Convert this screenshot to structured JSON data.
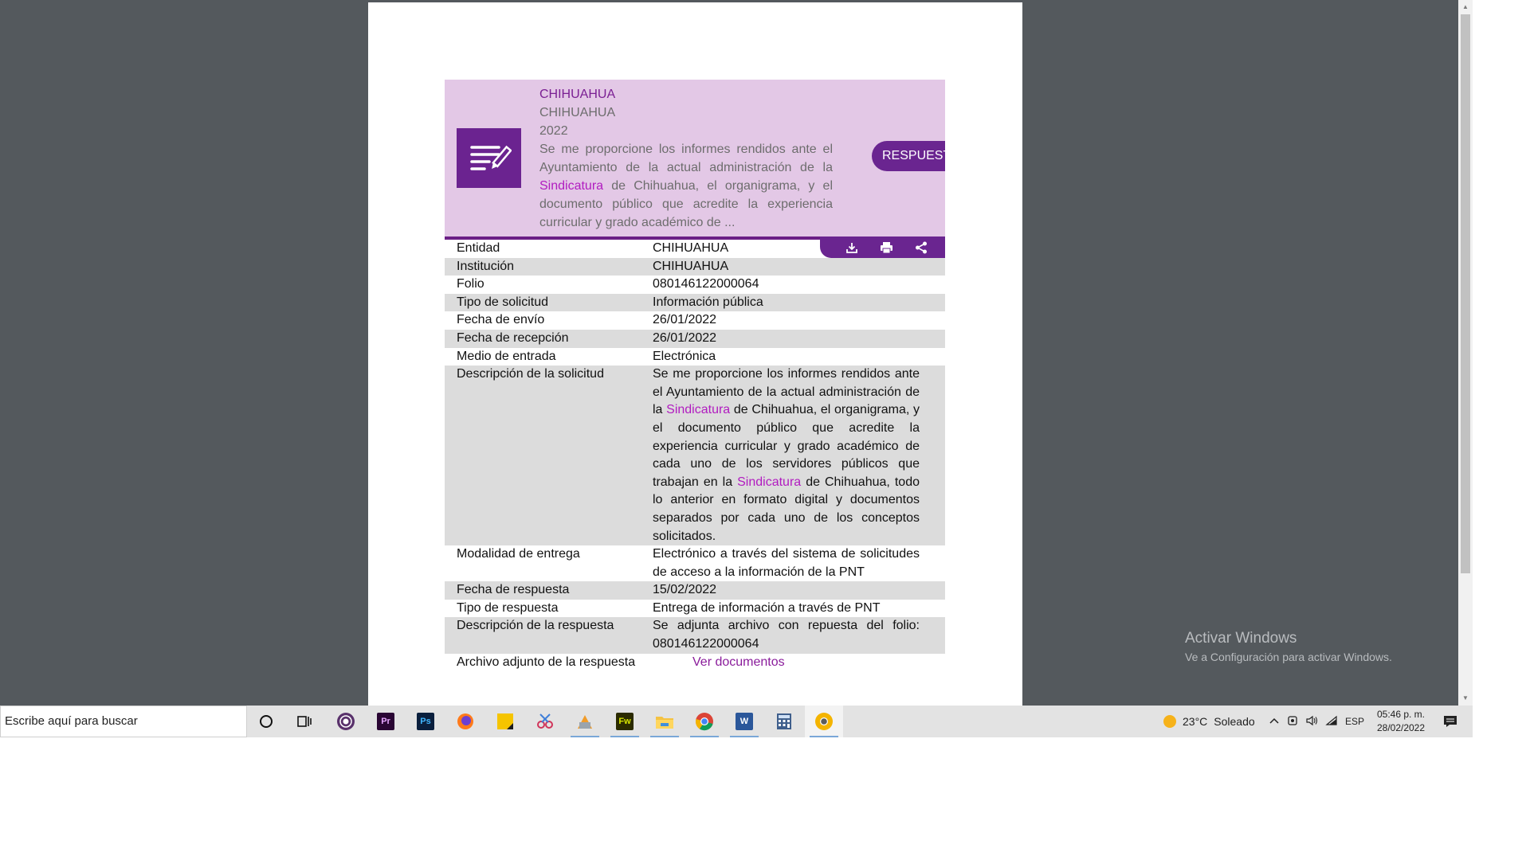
{
  "card": {
    "entity": "CHIHUAHUA",
    "institution": "CHIHUAHUA",
    "year": "2022",
    "summary_parts": [
      "Se me proporcione los informes rendidos ante el Ayuntamiento de la actual administración de la ",
      "Sindicatura",
      " de Chihuahua, el organigrama, y el documento público que acredite la experiencia curricular y grado académico de ..."
    ],
    "respuesta_label": "RESPUESTA",
    "accent_color": "#6a2590",
    "toolbar_icons": [
      "download-icon",
      "print-icon",
      "share-icon"
    ]
  },
  "details": {
    "rows": [
      {
        "label": "Entidad",
        "value": "CHIHUAHUA"
      },
      {
        "label": "Institución",
        "value": "CHIHUAHUA"
      },
      {
        "label": "Folio",
        "value": "080146122000064"
      },
      {
        "label": "Tipo de solicitud",
        "value": "Información pública"
      },
      {
        "label": "Fecha de envío",
        "value": "26/01/2022"
      },
      {
        "label": "Fecha de recepción",
        "value": "26/01/2022"
      },
      {
        "label": "Medio de entrada",
        "value": "Electrónica"
      }
    ],
    "descripcion": {
      "label": "Descripción de la solicitud",
      "parts": [
        "Se me proporcione los informes rendidos ante el Ayuntamiento de la actual administración de la ",
        "Sindicatura",
        " de Chihuahua, el organigrama, y el documento público que acredite la experiencia curricular y grado académico de cada uno de los servidores públicos que trabajan en la ",
        "Sindicatura",
        " de Chihuahua, todo lo anterior en formato digital y documentos separados por cada uno de los conceptos solicitados."
      ]
    },
    "rows_after": [
      {
        "label": "Modalidad de entrega",
        "value": "Electrónico a través del sistema de solicitudes de acceso a la información de la PNT"
      },
      {
        "label": "Fecha de respuesta",
        "value": "15/02/2022"
      },
      {
        "label": "Tipo de respuesta",
        "value": "Entrega de información a través de PNT"
      },
      {
        "label": "Descripción de la respuesta",
        "value": "Se adjunta archivo con repuesta del folio: 080146122000064"
      }
    ],
    "archivo": {
      "label": "Archivo adjunto de la respuesta",
      "link": "Ver documentos"
    }
  },
  "watermark": {
    "title": "Activar Windows",
    "subtitle": "Ve a Configuración para activar Windows."
  },
  "taskbar": {
    "search_placeholder": "Escribe aquí para buscar",
    "apps": [
      {
        "icon": "cortana-icon"
      },
      {
        "icon": "task-view-icon"
      },
      {
        "icon": "tor-browser-icon"
      },
      {
        "icon": "premiere-icon",
        "glyph": "Pr"
      },
      {
        "icon": "photoshop-icon",
        "glyph": "Ps"
      },
      {
        "icon": "firefox-icon"
      },
      {
        "icon": "sticky-notes-icon"
      },
      {
        "icon": "snipping-tool-icon"
      },
      {
        "icon": "illustrator-icon"
      },
      {
        "icon": "fireworks-icon",
        "glyph": "Fw"
      },
      {
        "icon": "file-explorer-icon"
      },
      {
        "icon": "chrome-icon"
      },
      {
        "icon": "word-icon",
        "glyph": "W"
      },
      {
        "icon": "calculator-icon"
      },
      {
        "icon": "chrome-canary-icon"
      }
    ],
    "weather": {
      "temp": "23°C",
      "condition": "Soleado"
    },
    "language": "ESP",
    "time": "05:46 p. m.",
    "date": "28/02/2022"
  }
}
